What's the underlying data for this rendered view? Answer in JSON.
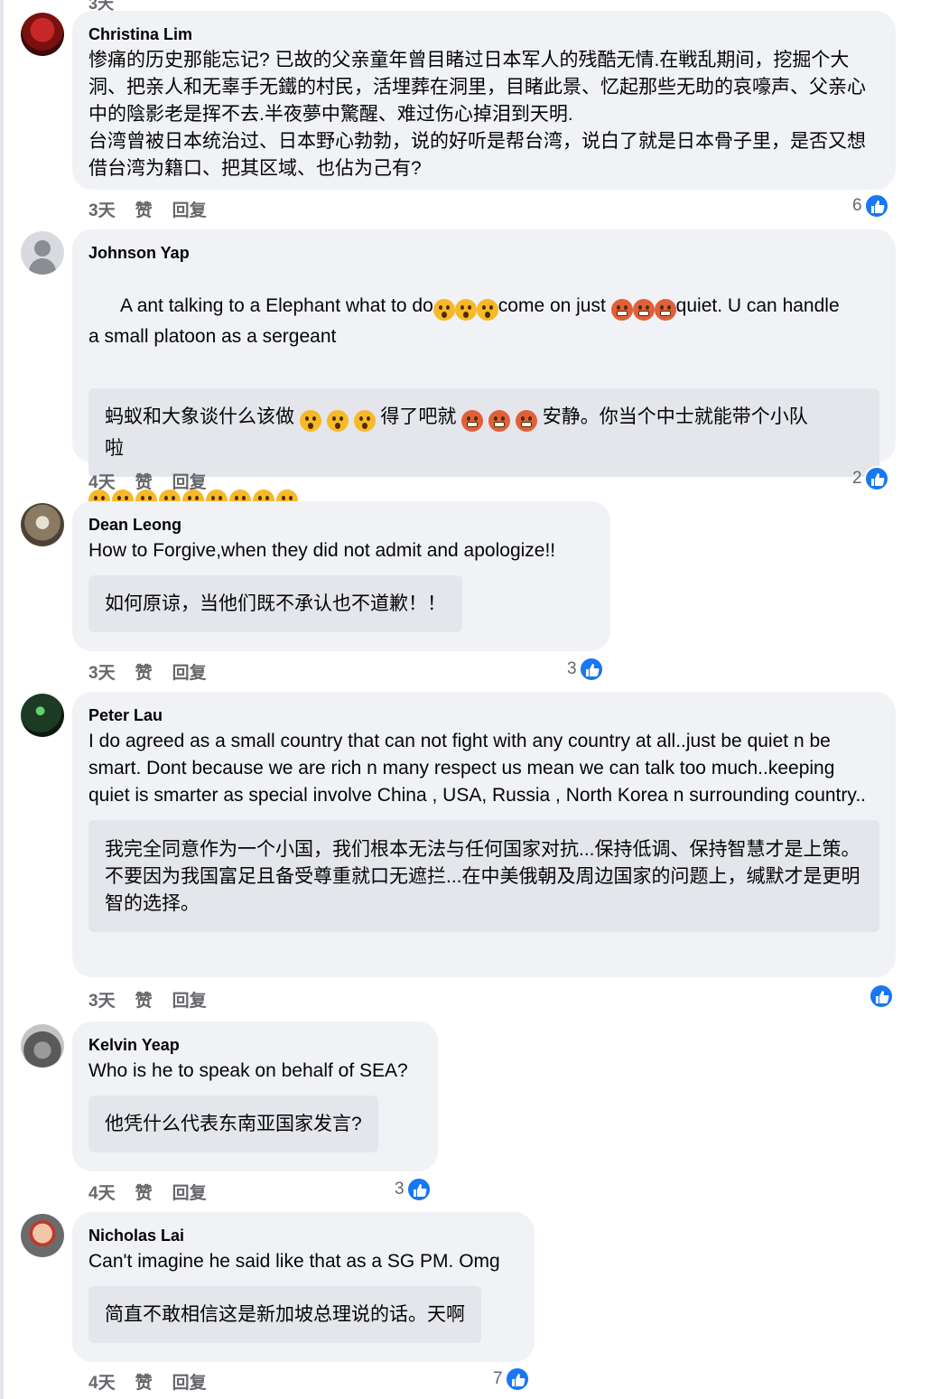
{
  "top_cut_text": "3天",
  "action_like": "赞",
  "action_reply": "回复",
  "comments": [
    {
      "author": "Christina Lim",
      "text": "惨痛的历史那能忘记? 已故的父亲童年曾目睹过日本军人的残酷无情.在戦乱期间，挖掘个大洞、把亲人和无辜手无鐵的村民，活埋葬在洞里，目睹此景、忆起那些无助的哀嚎声、父亲心中的陰影老是挥不去.半夜夢中驚醒、难过伤心掉泪到天明.\n台湾曾被日本统治过、日本野心勃勃，说的好听是帮台湾，说白了就是日本骨子里，是否又想借台湾为籍口、把其区域、也佔为己有?",
      "time": "3天",
      "likes": "6"
    },
    {
      "author": "Johnson Yap",
      "text_a": "A ant talking to a Elephant what to do",
      "text_b": "come on just ",
      "text_c": "quiet. U can handle",
      "text_d": "a small platoon as a sergeant",
      "translation_a": "蚂蚁和大象谈什么该做 ",
      "translation_b": " 得了吧就 ",
      "translation_c": " 安静。你当个中士就能带个小队",
      "translation_d": "啦",
      "time": "4天",
      "likes": "2"
    },
    {
      "author": "Dean Leong",
      "text": "How to Forgive,when they did not admit and apologize!!",
      "translation": "如何原谅，当他们既不承认也不道歉！！",
      "time": "3天",
      "likes": "3"
    },
    {
      "author": "Peter Lau",
      "text": "I do agreed as a small country that can not fight with any country at all..just be quiet n be smart. Dont because we are rich n many respect us mean we can talk too much..keeping quiet is smarter as special involve China , USA, Russia , North Korea n surrounding country..",
      "translation": "我完全同意作为一个小国，我们根本无法与任何国家对抗...保持低调、保持智慧才是上策。不要因为我国富足且备受尊重就口无遮拦...在中美俄朝及周边国家的问题上，缄默才是更明智的选择。",
      "time": "3天",
      "likes": ""
    },
    {
      "author": "Kelvin Yeap",
      "text": "Who is he to speak on behalf of SEA?",
      "translation": "他凭什么代表东南亚国家发言?",
      "time": "4天",
      "likes": "3"
    },
    {
      "author": "Nicholas Lai",
      "text": "Can't imagine he said like that as a SG PM. Omg",
      "translation": "简直不敢相信这是新加坡总理说的话。天啊",
      "time": "4天",
      "likes": "7"
    }
  ],
  "colors": {
    "bubble": "#f0f2f5",
    "translation_bg": "#e4e6eb",
    "meta_text": "#65676b",
    "like_blue": "#1877f2"
  }
}
